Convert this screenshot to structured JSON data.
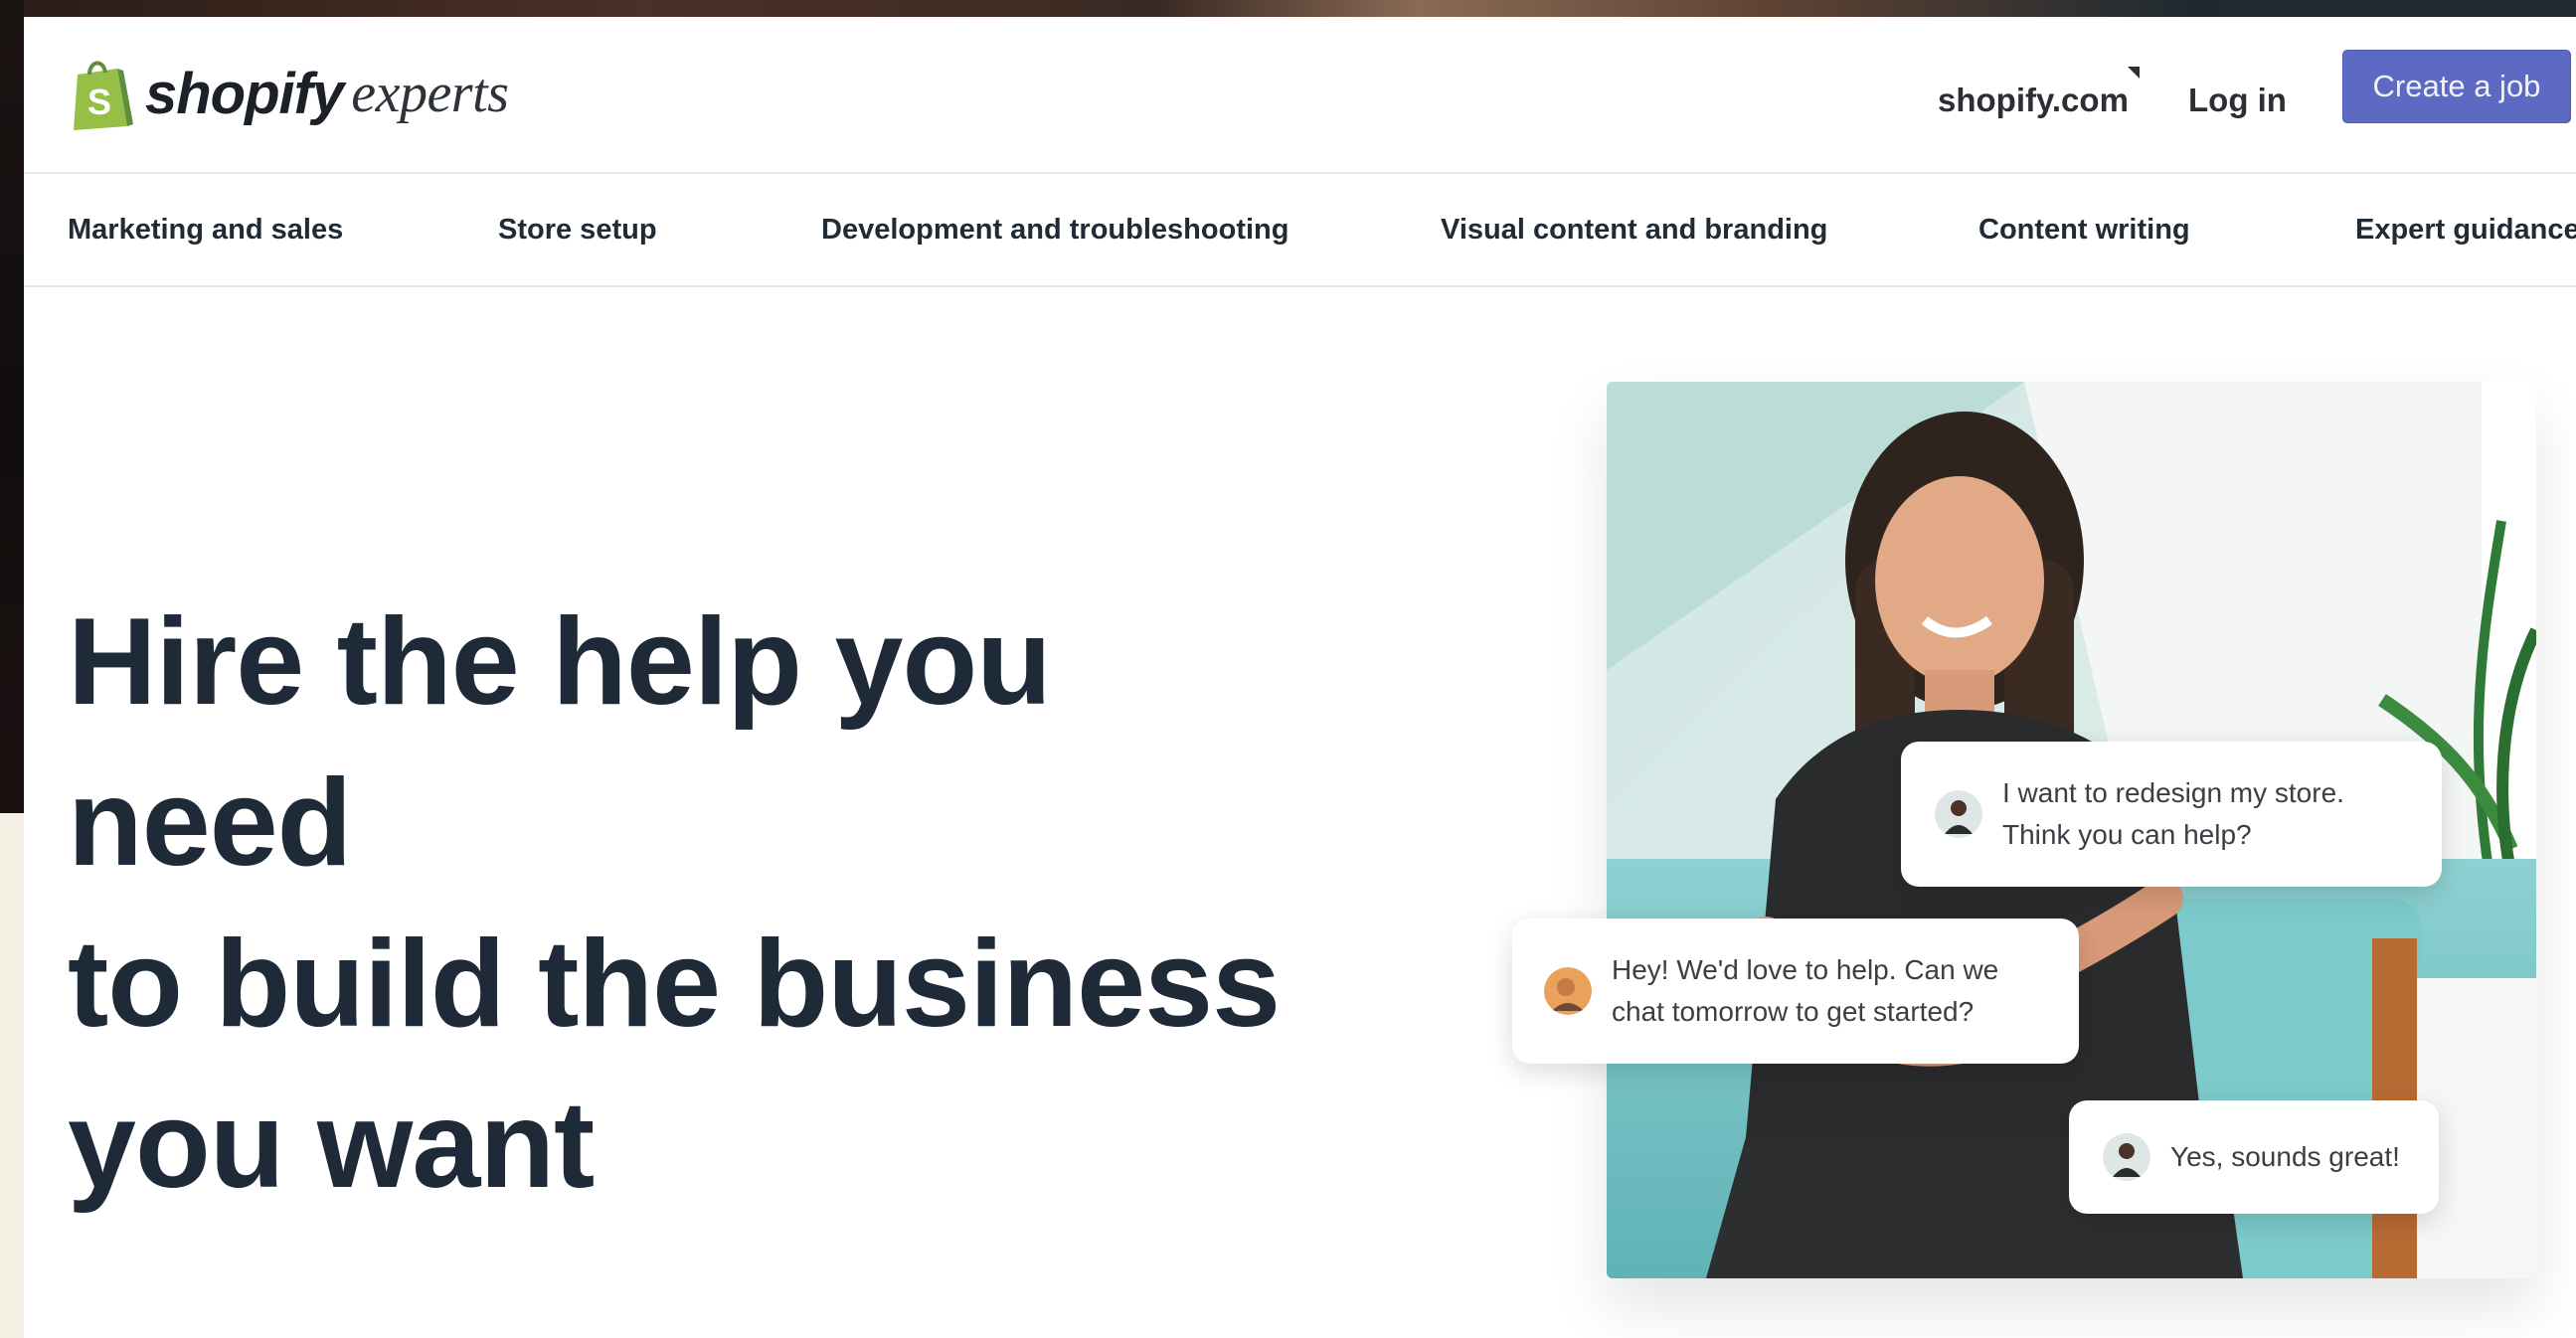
{
  "header": {
    "logo_word": "shopify",
    "logo_sub": "experts",
    "shopify_link": "shopify.com",
    "login": "Log in",
    "create_job": "Create a job"
  },
  "categories": [
    "Marketing and sales",
    "Store setup",
    "Development and troubleshooting",
    "Visual content and branding",
    "Content writing",
    "Expert guidance"
  ],
  "hero": {
    "title_line1": "Hire the help you need",
    "title_line2": "to build the business",
    "title_line3": "you want"
  },
  "chat": {
    "message_1": "I want to redesign my store.\nThink you can help?",
    "message_2": "Hey! We'd love to help. Can we\nchat tomorrow to get started?",
    "message_3": "Yes, sounds great!"
  },
  "colors": {
    "brand_green": "#95bf47",
    "button_purple": "#5c6ac4",
    "text_dark": "#212b36"
  }
}
